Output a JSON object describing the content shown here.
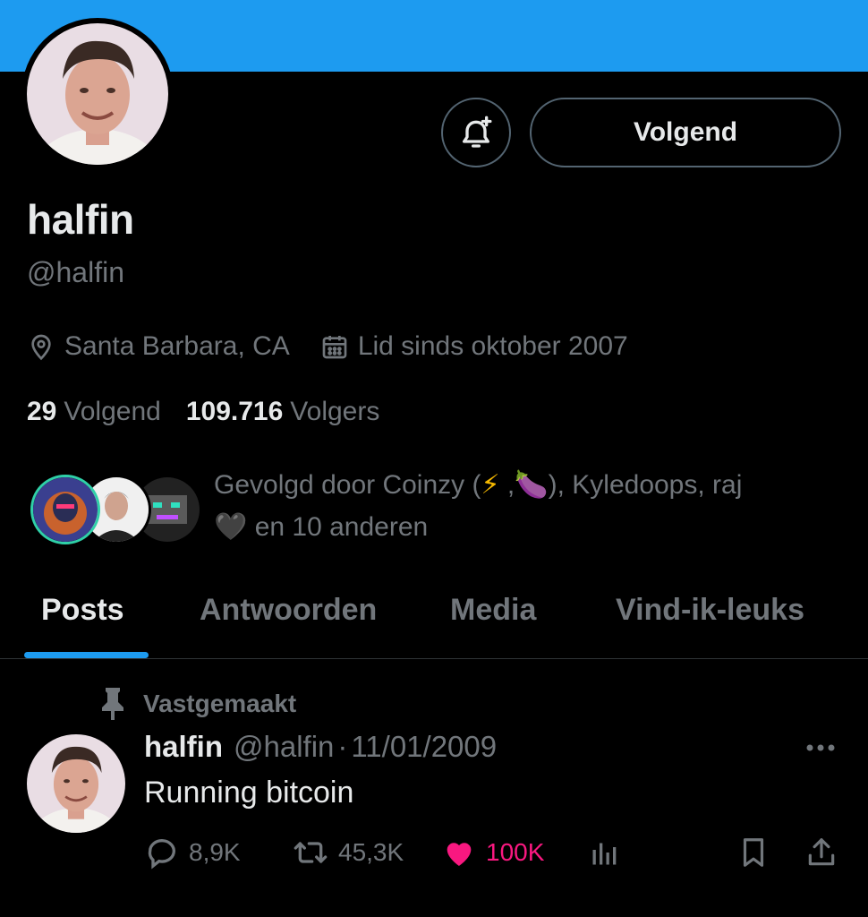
{
  "profile": {
    "display_name": "halfin",
    "handle": "@halfin",
    "location": "Santa Barbara, CA",
    "joined": "Lid sinds oktober 2007",
    "following_count": "29",
    "following_label": "Volgend",
    "followers_count": "109.716",
    "followers_label": "Volgers",
    "follow_button_label": "Volgend"
  },
  "followed_by": {
    "text_before": "Gevolgd door Coinzy (",
    "emoji_1": "⚡",
    "sep": ",",
    "emoji_2": "🍆",
    "text_after": "), Kyledoops, raj",
    "emoji_3": "🖤",
    "text_end": "en 10 anderen"
  },
  "tabs": [
    {
      "label": "Posts",
      "active": true
    },
    {
      "label": "Antwoorden",
      "active": false
    },
    {
      "label": "Media",
      "active": false
    },
    {
      "label": "Vind-ik-leuks",
      "active": false
    }
  ],
  "post": {
    "pinned_label": "Vastgemaakt",
    "author_name": "halfin",
    "author_handle": "@halfin",
    "date_sep": "·",
    "date": "11/01/2009",
    "text": "Running bitcoin",
    "replies": "8,9K",
    "reposts": "45,3K",
    "likes": "100K"
  },
  "colors": {
    "banner": "#1d9bf0",
    "accent": "#1d9bf0",
    "like": "#f91880",
    "muted": "#71767b"
  },
  "icons": [
    "bell-plus-icon",
    "location-pin-icon",
    "calendar-icon",
    "pin-icon",
    "more-icon",
    "reply-icon",
    "repost-icon",
    "heart-icon",
    "analytics-icon",
    "bookmark-icon",
    "share-icon"
  ]
}
